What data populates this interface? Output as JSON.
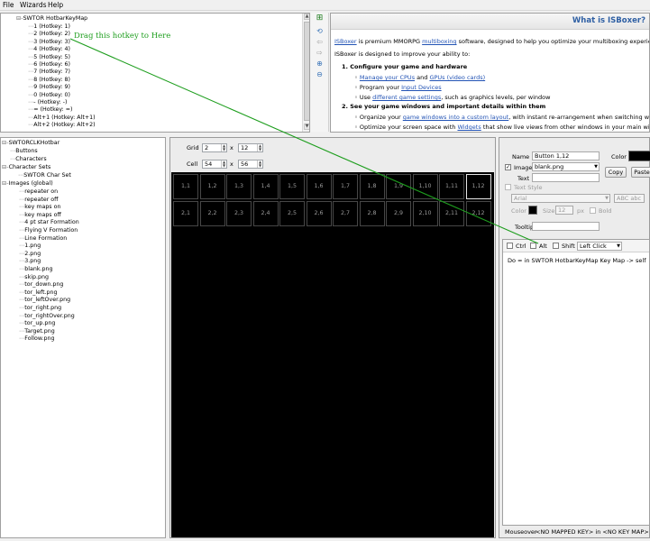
{
  "menu": [
    "File",
    "Wizards",
    "Help"
  ],
  "top_tree": {
    "root": "SWTOR HotbarKeyMap",
    "items": [
      "1 (Hotkey: 1)",
      "2 (Hotkey: 2)",
      "3 (Hotkey: 3)",
      "4 (Hotkey: 4)",
      "5 (Hotkey: 5)",
      "6 (Hotkey: 6)",
      "7 (Hotkey: 7)",
      "8 (Hotkey: 8)",
      "9 (Hotkey: 9)",
      "0 (Hotkey: 0)",
      "- (Hotkey: -)",
      "= (Hotkey: =)",
      "Alt+1 (Hotkey: Alt+1)",
      "Alt+2 (Hotkey: Alt+2)"
    ]
  },
  "annotation": {
    "text": "Drag this hotkey to Here",
    "color": "#1e9e1e"
  },
  "info_panel": {
    "title": "What is ISBoxer?",
    "intro_link": "ISBoxer",
    "intro_a": " is premium MMORPG ",
    "intro_link2": "multiboxing",
    "intro_b": " software, designed to help you optimize your multiboxing experience on your P",
    "designed": "ISBoxer is designed to improve your ability to:",
    "h1": "1.  Configure your game and hardware",
    "b1_link": "Manage your CPUs",
    "b1_and": " and ",
    "b1_link2": "GPUs (video cards)",
    "b2_text": "Program your ",
    "b2_link": "Input Devices",
    "b3_text": "Use ",
    "b3_link": "different game settings",
    "b3_tail": ", such as graphics levels, per window",
    "h2": "2.  See your game windows and important details within them",
    "b4_text": "Organize your ",
    "b4_link": "game windows into a custom layout",
    "b4_tail": ", with instant re-arrangement when switching windows. Cho",
    "b5_text": "Optimize your screen space with ",
    "b5_link": "Widgets",
    "b5_tail": " that show live views from other windows in your main window, or apply"
  },
  "left_tree": {
    "root": "SWTORCLKHotbar",
    "children": [
      "Buttons",
      "Characters"
    ],
    "char_sets": "Character Sets",
    "char_set_item": "SWTOR Char Set",
    "images": "Images (global)",
    "image_items": [
      "repeater on",
      "repeater off",
      "key maps on",
      "key maps off",
      "4 pt star Formation",
      "Flying V Formation",
      "Line Formation",
      "1.png",
      "2.png",
      "3.png",
      "blank.png",
      "skip.png",
      "tor_down.png",
      "tor_left.png",
      "tor_leftOver.png",
      "tor_right.png",
      "tor_rightOver.png",
      "tor_up.png",
      "Target.png",
      "Follow.png"
    ]
  },
  "grid_editor": {
    "grid_label": "Grid",
    "grid_x": "2",
    "grid_y": "12",
    "cell_label": "Cell",
    "cell_x": "54",
    "cell_y": "56",
    "times": "x",
    "rows": [
      [
        "1,1",
        "1,2",
        "1,3",
        "1,4",
        "1,5",
        "1,6",
        "1,7",
        "1,8",
        "1,9",
        "1,10",
        "1,11",
        "1,12"
      ],
      [
        "2,1",
        "2,2",
        "2,3",
        "2,4",
        "2,5",
        "2,6",
        "2,7",
        "2,8",
        "2,9",
        "2,10",
        "2,11",
        "2,12"
      ]
    ],
    "selected": "1,12"
  },
  "properties": {
    "name_label": "Name",
    "name_value": "Button 1,12",
    "color_label": "Color",
    "color_value": "#000000",
    "image_label": "Image",
    "image_value": "blank.png",
    "copy_label": "Copy",
    "paste_label": "Paste",
    "text_label": "Text",
    "text_style_label": "Text Style",
    "font_value": "Arial",
    "font_preview": "ABC abc",
    "tcolor_label": "Color",
    "size_label": "Size",
    "size_value": "12",
    "px_label": "px",
    "bold_label": "Bold",
    "tooltip_label": "Tooltip",
    "ctrl_label": "Ctrl",
    "alt_label": "Alt",
    "shift_label": "Shift",
    "click_value": "Left Click",
    "action_text": "Do = in SWTOR HotbarKeyMap Key Map -> self",
    "mouseover_label": "Mouseover",
    "mouseover_value": "<NO MAPPED KEY> in <NO KEY MAP>"
  }
}
